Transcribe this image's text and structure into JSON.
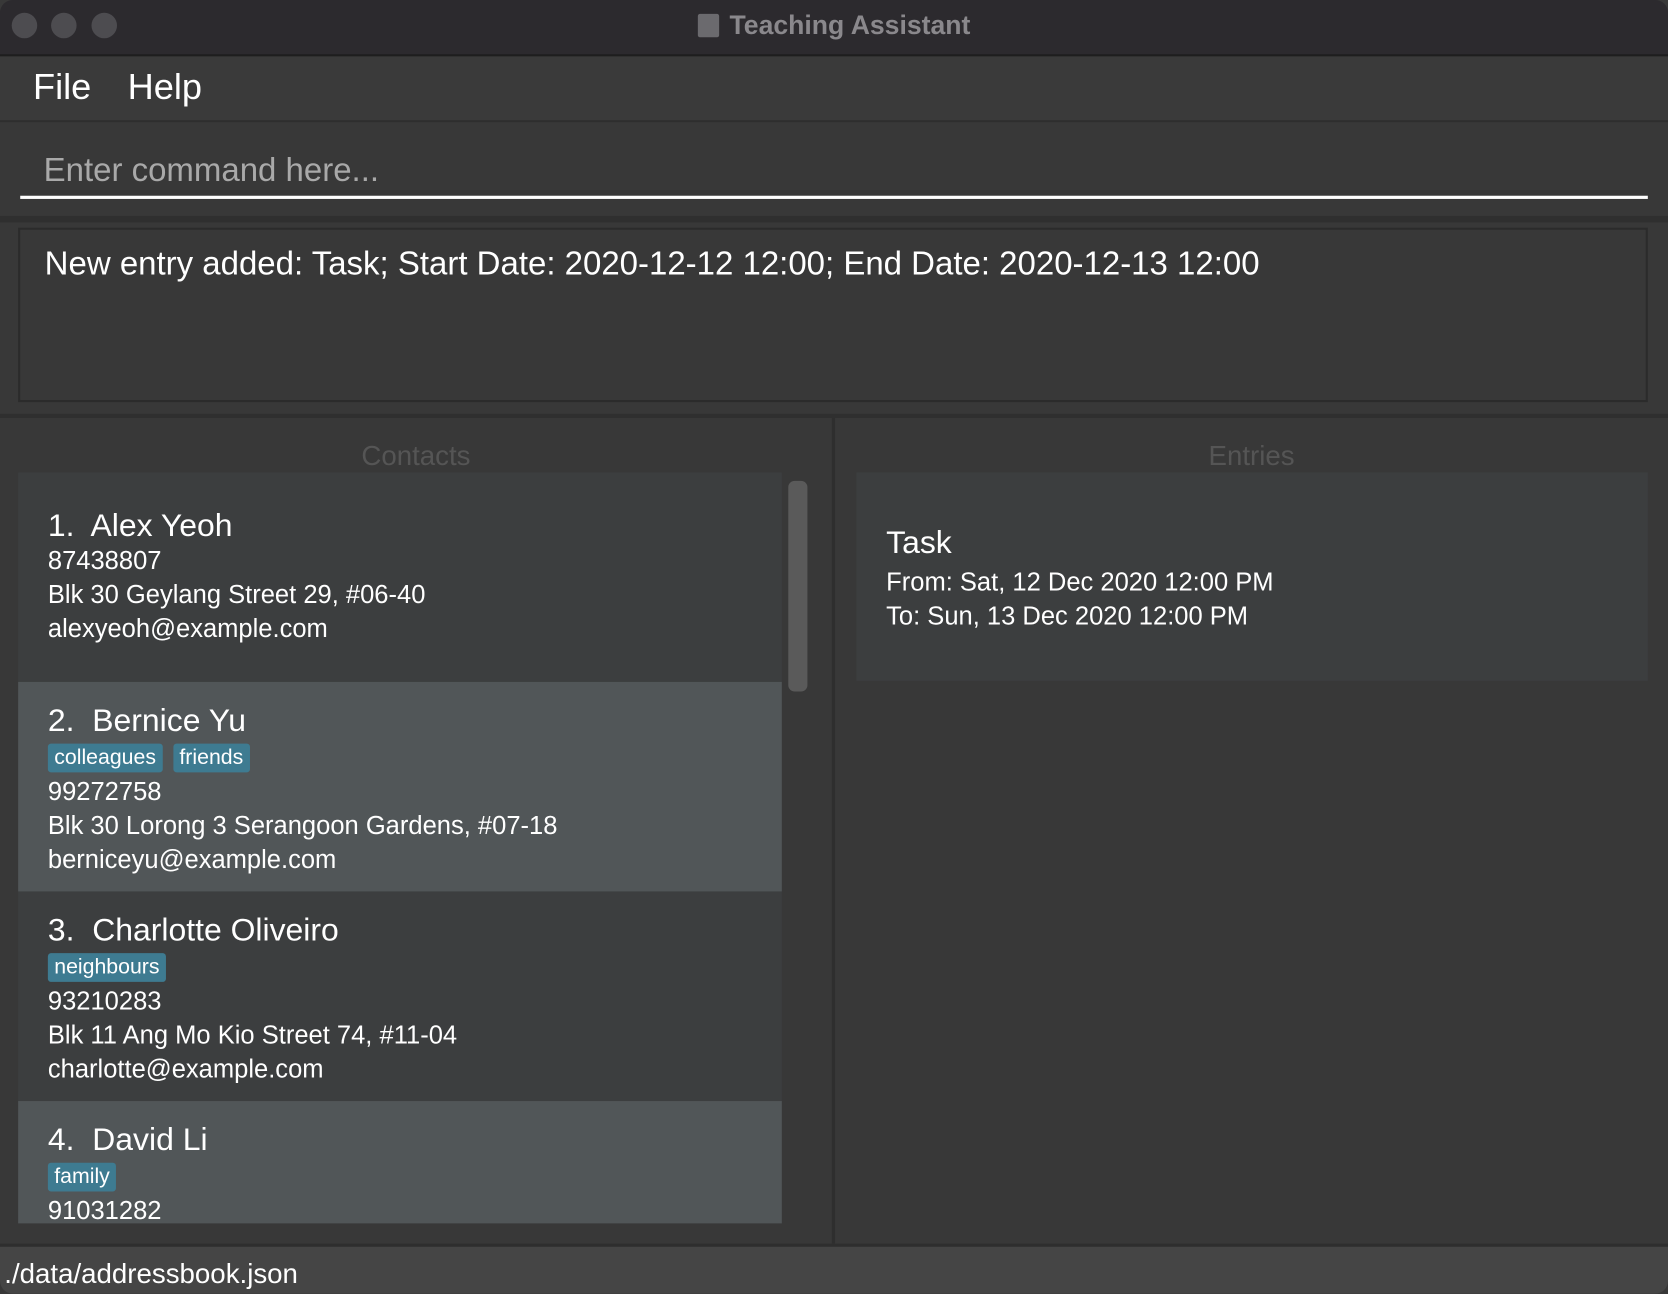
{
  "window": {
    "title": "Teaching Assistant"
  },
  "menu": {
    "file": "File",
    "help": "Help"
  },
  "command": {
    "placeholder": "Enter command here...",
    "value": ""
  },
  "result": {
    "text": "New entry added: Task; Start Date: 2020-12-12 12:00; End Date: 2020-12-13 12:00"
  },
  "contacts": {
    "title": "Contacts",
    "items": [
      {
        "index": "1.",
        "name": "Alex Yeoh",
        "tags": [],
        "phone": "87438807",
        "address": "Blk 30 Geylang Street 29, #06-40",
        "email": "alexyeoh@example.com"
      },
      {
        "index": "2.",
        "name": "Bernice Yu",
        "tags": [
          "colleagues",
          "friends"
        ],
        "phone": "99272758",
        "address": "Blk 30 Lorong 3 Serangoon Gardens, #07-18",
        "email": "berniceyu@example.com"
      },
      {
        "index": "3.",
        "name": "Charlotte Oliveiro",
        "tags": [
          "neighbours"
        ],
        "phone": "93210283",
        "address": "Blk 11 Ang Mo Kio Street 74, #11-04",
        "email": "charlotte@example.com"
      },
      {
        "index": "4.",
        "name": "David Li",
        "tags": [
          "family"
        ],
        "phone": "91031282"
      }
    ]
  },
  "entries": {
    "title": "Entries",
    "items": [
      {
        "title": "Task",
        "from": "From: Sat, 12 Dec 2020 12:00 PM",
        "to": "To: Sun, 13 Dec 2020 12:00 PM"
      }
    ]
  },
  "status": {
    "path": "./data/addressbook.json"
  },
  "colors": {
    "tag": "#3e7b91",
    "card_odd": "#3c3e3f",
    "card_even": "#515658"
  }
}
